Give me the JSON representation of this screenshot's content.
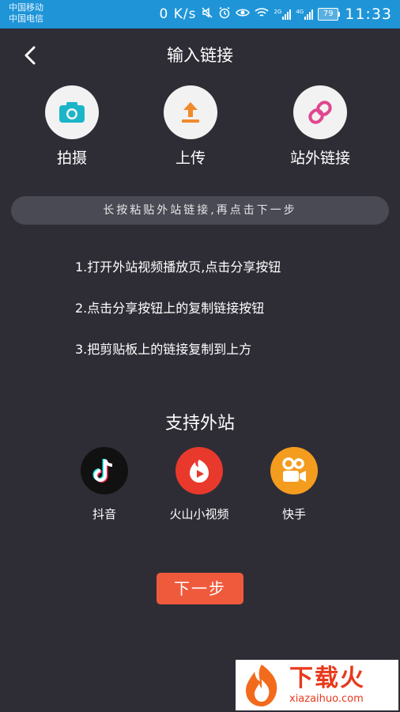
{
  "status_bar": {
    "carrier_1": "中国移动",
    "carrier_2": "中国电信",
    "net_speed": "0 K/s",
    "signal_1_label": "2G",
    "signal_2_label": "4G",
    "battery": "79",
    "time": "11:33",
    "icons": [
      "mute-icon",
      "alarm-icon",
      "eye-icon",
      "wifi-icon",
      "signal-icon",
      "battery-icon"
    ]
  },
  "header": {
    "title": "输入链接",
    "back_icon": "chevron-left-icon"
  },
  "actions": [
    {
      "label": "拍摄",
      "icon": "camera-icon",
      "color": "#1ab5c8"
    },
    {
      "label": "上传",
      "icon": "upload-icon",
      "color": "#f08a2c"
    },
    {
      "label": "站外链接",
      "icon": "link-icon",
      "color": "#e0458f"
    }
  ],
  "hint": "长按粘贴外站链接,再点击下一步",
  "steps": [
    "1.打开外站视频播放页,点击分享按钮",
    "2.点击分享按钮上的复制链接按钮",
    "3.把剪贴板上的链接复制到上方"
  ],
  "support": {
    "title": "支持外站",
    "sites": [
      {
        "label": "抖音",
        "icon": "douyin-icon",
        "color": "#111111"
      },
      {
        "label": "火山小视频",
        "icon": "huoshan-icon",
        "color": "#e8392c"
      },
      {
        "label": "快手",
        "icon": "kuaishou-icon",
        "color": "#f39c1e"
      }
    ]
  },
  "next_button": "下一步",
  "watermark": {
    "text": "下载火",
    "url": "xiazaihuo.com"
  },
  "colors": {
    "background": "#2e2d36",
    "status_bar": "#1f95d8",
    "accent": "#f05a3c"
  }
}
